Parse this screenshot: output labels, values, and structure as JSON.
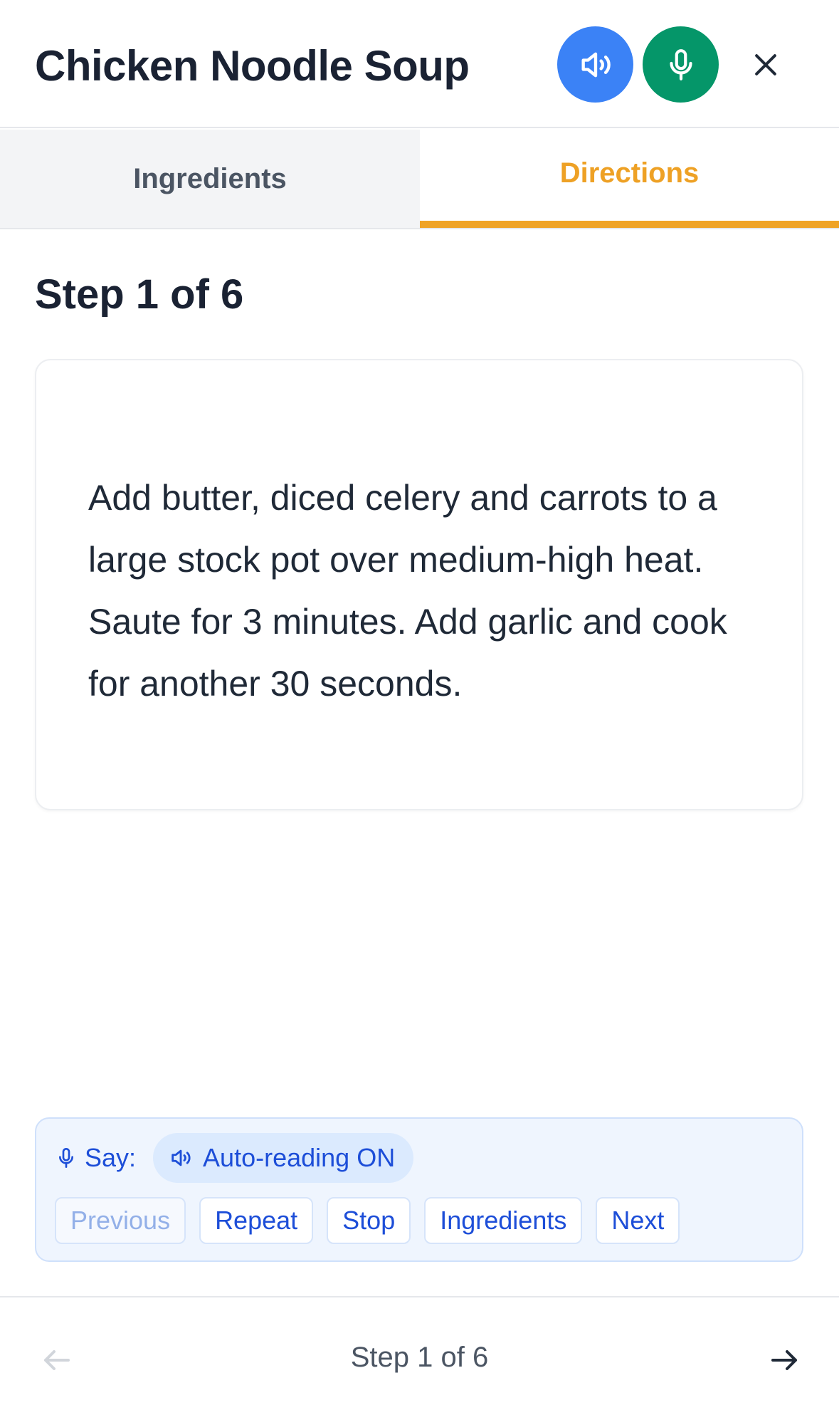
{
  "header": {
    "title": "Chicken Noodle Soup",
    "speaker_icon": "speaker-icon",
    "mic_icon": "microphone-icon",
    "close_icon": "close-icon"
  },
  "tabs": [
    {
      "label": "Ingredients",
      "active": false
    },
    {
      "label": "Directions",
      "active": true
    }
  ],
  "step": {
    "heading": "Step 1 of 6",
    "text": "Add butter, diced celery and carrots to a large stock pot over medium-high heat. Saute for 3 minutes. Add garlic and cook for another 30 seconds."
  },
  "voice": {
    "say_label": "Say:",
    "auto_reading": "Auto-reading ON",
    "commands": [
      {
        "label": "Previous",
        "enabled": false
      },
      {
        "label": "Repeat",
        "enabled": true
      },
      {
        "label": "Stop",
        "enabled": true
      },
      {
        "label": "Ingredients",
        "enabled": true
      },
      {
        "label": "Next",
        "enabled": true
      }
    ]
  },
  "footer": {
    "label": "Step 1 of 6",
    "prev_icon": "arrow-left-icon",
    "next_icon": "arrow-right-icon"
  },
  "colors": {
    "accent": "#efa326",
    "speaker_button": "#3b82f6",
    "mic_button": "#059669",
    "voice_text": "#1d4ed8"
  }
}
